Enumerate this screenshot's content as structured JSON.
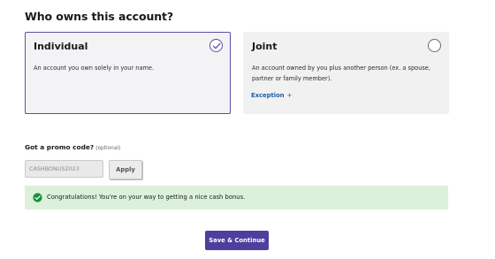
{
  "page": {
    "title": "Who owns this account?"
  },
  "options": {
    "individual": {
      "title": "Individual",
      "description": "An account you own solely in your name.",
      "selected": true
    },
    "joint": {
      "title": "Joint",
      "description": "An account owned by you plus another person (ex. a spouse, partner or family member).",
      "selected": false,
      "link_label": "Exception",
      "link_icon": "+"
    }
  },
  "promo": {
    "label": "Got a promo code?",
    "optional_label": "(optional)",
    "input_value": "CASHBONUS2023",
    "apply_label": "Apply"
  },
  "success": {
    "message": "Congratulations! You're on your way to getting a nice cash bonus.",
    "icon": "check-circle-icon"
  },
  "actions": {
    "save_label": "Save & Continue"
  },
  "colors": {
    "accent": "#4e3f9e",
    "selected_border": "#5c4da8",
    "link": "#1f5ea8",
    "success_bg": "#dbf1dc",
    "success_icon": "#1d8f3c"
  }
}
